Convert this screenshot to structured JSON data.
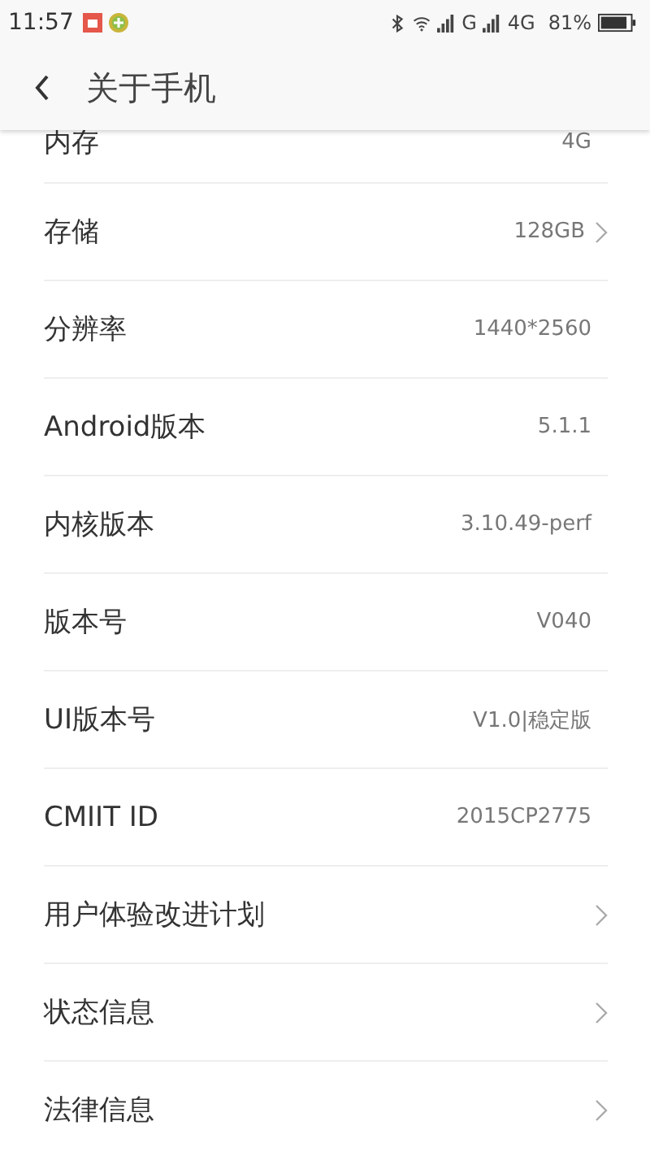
{
  "status_bar": {
    "time": "11:57",
    "network_1": "G",
    "network_2": "4G",
    "battery": "81%"
  },
  "header": {
    "title": "关于手机"
  },
  "rows": [
    {
      "label": "内存",
      "value": "4G",
      "chevron": false
    },
    {
      "label": "存储",
      "value": "128GB",
      "chevron": true
    },
    {
      "label": "分辨率",
      "value": "1440*2560",
      "chevron": false
    },
    {
      "label": "Android版本",
      "value": "5.1.1",
      "chevron": false
    },
    {
      "label": "内核版本",
      "value": "3.10.49-perf",
      "chevron": false
    },
    {
      "label": "版本号",
      "value": "V040",
      "chevron": false
    },
    {
      "label": "UI版本号",
      "value": "V1.0|稳定版",
      "chevron": false
    },
    {
      "label": "CMIIT ID",
      "value": "2015CP2775",
      "chevron": false
    },
    {
      "label": "用户体验改进计划",
      "chevron": true
    },
    {
      "label": "状态信息",
      "chevron": true
    },
    {
      "label": "法律信息",
      "chevron": true
    }
  ]
}
